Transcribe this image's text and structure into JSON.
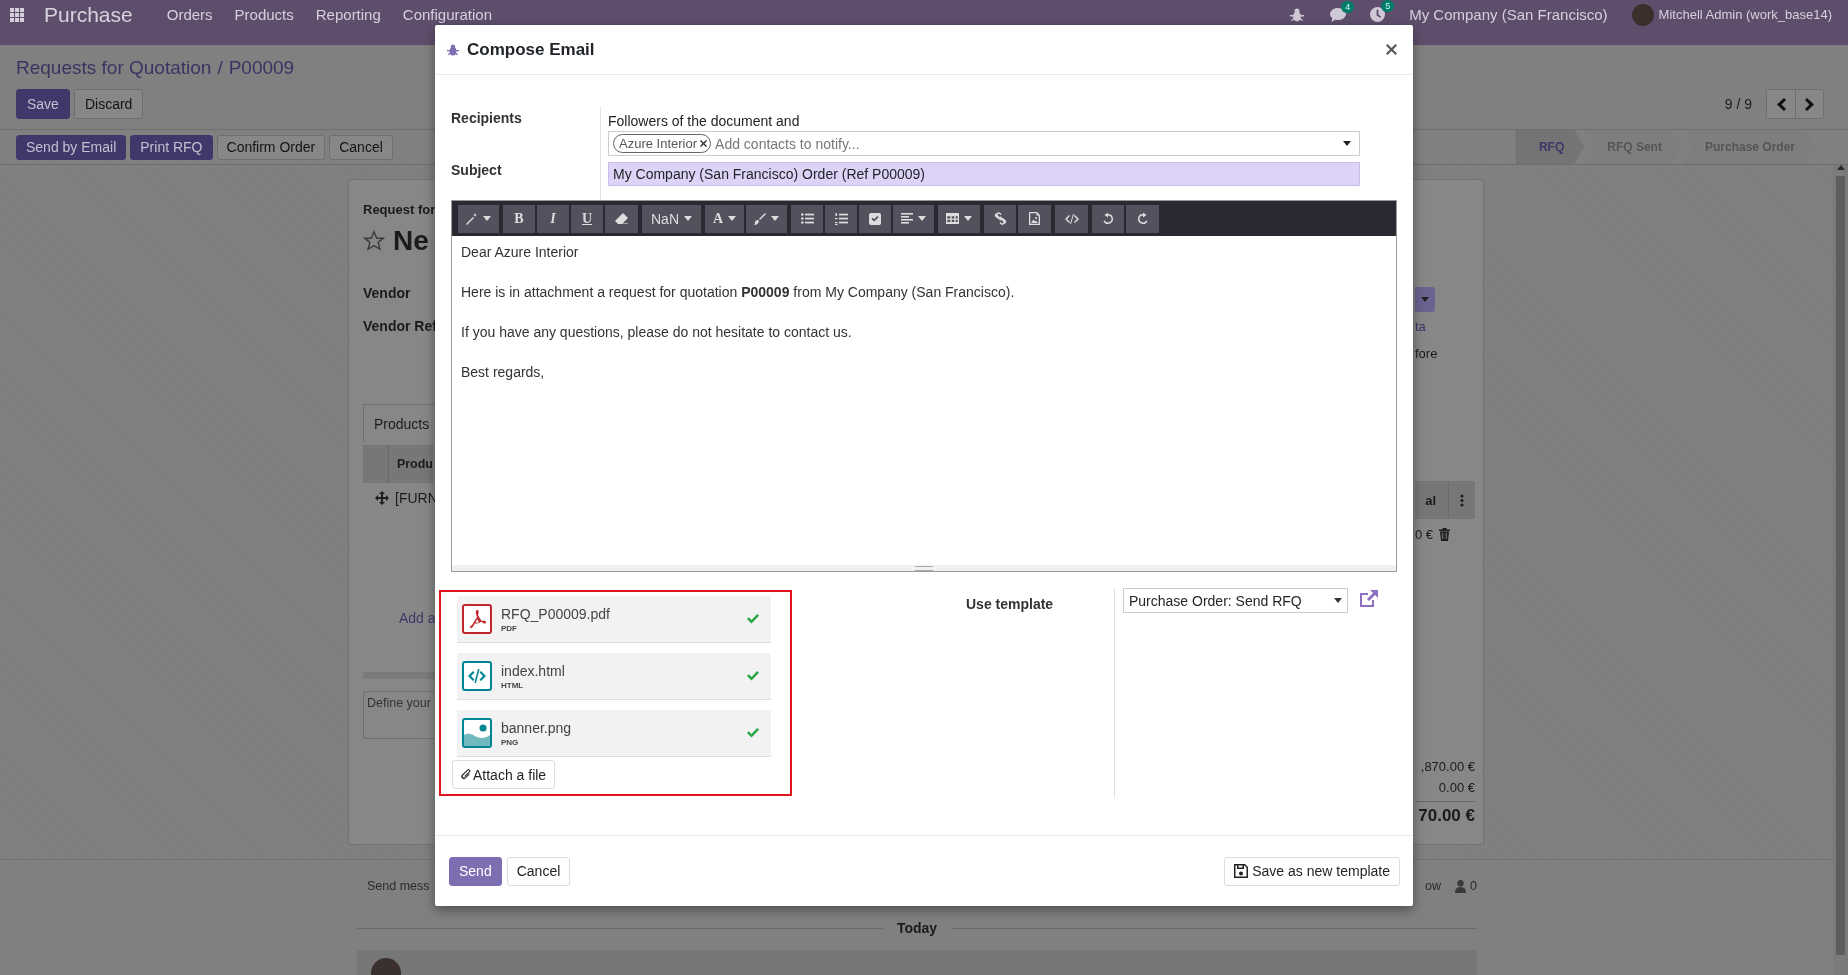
{
  "navbar": {
    "app": "Purchase",
    "menu": [
      "Orders",
      "Products",
      "Reporting",
      "Configuration"
    ],
    "badges": [
      "4",
      "5"
    ],
    "company": "My Company (San Francisco)",
    "user": "Mitchell Admin (work_base14)"
  },
  "control_panel": {
    "breadcrumb": {
      "parent": "Requests for Quotation",
      "separator": "/",
      "current": "P00009"
    },
    "buttons": [
      {
        "label": "Save",
        "kind": "primary"
      },
      {
        "label": "Discard",
        "kind": "secondary"
      }
    ],
    "pager": "9 / 9",
    "actions": [
      {
        "label": "Send by Email",
        "kind": "primary"
      },
      {
        "label": "Print RFQ",
        "kind": "primary"
      },
      {
        "label": "Confirm Order",
        "kind": "secondary"
      },
      {
        "label": "Cancel",
        "kind": "secondary"
      }
    ],
    "statusbar": [
      {
        "label": "RFQ",
        "selected": true
      },
      {
        "label": "RFQ Sent",
        "selected": false
      },
      {
        "label": "Purchase Order",
        "selected": false
      }
    ]
  },
  "sheet": {
    "subtitle": "Request for",
    "title": "Ne",
    "vendor_label": "Vendor",
    "vendor_ref_label": "Vendor Ref",
    "tab": "Products",
    "column_1": "Produ",
    "row_text": "[FURN",
    "add_line": "Add a",
    "notes_placeholder": "Define your",
    "link_fragment": "ta",
    "text_fragment": "fore",
    "column_2": "al",
    "row_amount": "0 €",
    "totals": [
      ",870.00 €",
      "0.00 €",
      "70.00 €"
    ]
  },
  "chatter": {
    "send_message": "Send mess",
    "follow": "ow",
    "followers": "0",
    "today": "Today"
  },
  "dialog": {
    "title": "Compose Email",
    "recipients": {
      "label": "Recipients",
      "intro": "Followers of the document and",
      "tags": [
        "Azure Interior"
      ],
      "placeholder": "Add contacts to notify..."
    },
    "subject": {
      "label": "Subject",
      "value": "My Company (San Francisco) Order (Ref P00009)"
    },
    "toolbar": [
      [
        {
          "kind": "magic"
        }
      ],
      [
        {
          "kind": "bold",
          "label": "B"
        },
        {
          "kind": "italic",
          "label": "I"
        },
        {
          "kind": "underline",
          "label": "U"
        },
        {
          "kind": "eraser"
        }
      ],
      [
        {
          "kind": "size",
          "label": "NaN"
        }
      ],
      [
        {
          "kind": "color",
          "label": "A"
        },
        {
          "kind": "brush"
        }
      ],
      [
        {
          "kind": "bullets"
        },
        {
          "kind": "numbers"
        },
        {
          "kind": "checklist"
        },
        {
          "kind": "align"
        }
      ],
      [
        {
          "kind": "table"
        }
      ],
      [
        {
          "kind": "link"
        },
        {
          "kind": "image"
        }
      ],
      [
        {
          "kind": "code"
        }
      ],
      [
        {
          "kind": "undo"
        },
        {
          "kind": "redo"
        }
      ]
    ],
    "body": [
      "Dear Azure Interior",
      "Here is in attachment a request for quotation **P00009** from My Company (San Francisco).",
      "If you have any questions, please do not hesitate to contact us.",
      "Best regards,"
    ],
    "attachments": [
      {
        "name": "RFQ_P00009.pdf",
        "type": "PDF",
        "kind": "pdf",
        "uploaded": true
      },
      {
        "name": "index.html",
        "type": "HTML",
        "kind": "html",
        "uploaded": true
      },
      {
        "name": "banner.png",
        "type": "PNG",
        "kind": "image",
        "uploaded": true
      }
    ],
    "attach_button": "Attach a file",
    "template": {
      "label": "Use template",
      "value": "Purchase Order: Send RFQ"
    },
    "footer": {
      "send": "Send",
      "cancel": "Cancel",
      "save_template": "Save as new template"
    }
  }
}
